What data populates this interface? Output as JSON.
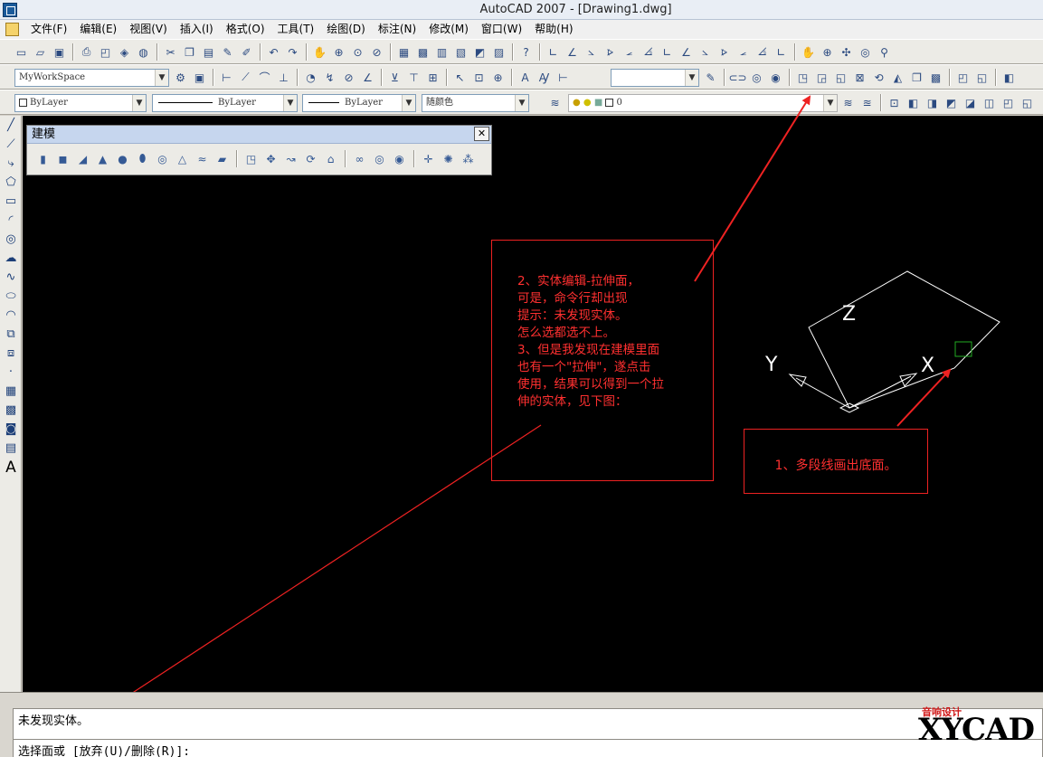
{
  "window": {
    "title": "AutoCAD 2007 - [Drawing1.dwg]"
  },
  "menu": [
    "文件(F)",
    "编辑(E)",
    "视图(V)",
    "插入(I)",
    "格式(O)",
    "工具(T)",
    "绘图(D)",
    "标注(N)",
    "修改(M)",
    "窗口(W)",
    "帮助(H)"
  ],
  "toolbar2": {
    "workspace": "MyWorkSpace"
  },
  "toolbar3": {
    "layer": "ByLayer",
    "linetype1": "ByLayer",
    "linetype2": "ByLayer",
    "color": "随颜色",
    "layer_name": "0"
  },
  "float_toolbar": {
    "title": "建模",
    "close": "✕"
  },
  "note2": {
    "text": "2、实体编辑-拉伸面，\n可是，命令行却出现\n提示：未发现实体。\n怎么选都选不上。\n3、但是我发现在建模里面\n也有一个\"拉伸\"，遂点击\n使用，结果可以得到一个拉\n伸的实体，见下图："
  },
  "note1": {
    "text": "1、多段线画出底面。"
  },
  "axes": {
    "x": "X",
    "y": "Y",
    "z": "Z"
  },
  "command": {
    "history": "未发现实体。",
    "prompt_prefix": "选择面或",
    "prompt_rest": " [放弃(U)/删除(R)]:"
  },
  "watermark": {
    "small": "音响设计",
    "big": "XYCAD"
  },
  "colors": {
    "annotation": "#ff3030",
    "canvas": "#000000",
    "geometry": "#ffffff",
    "grip": "#22aa22"
  }
}
